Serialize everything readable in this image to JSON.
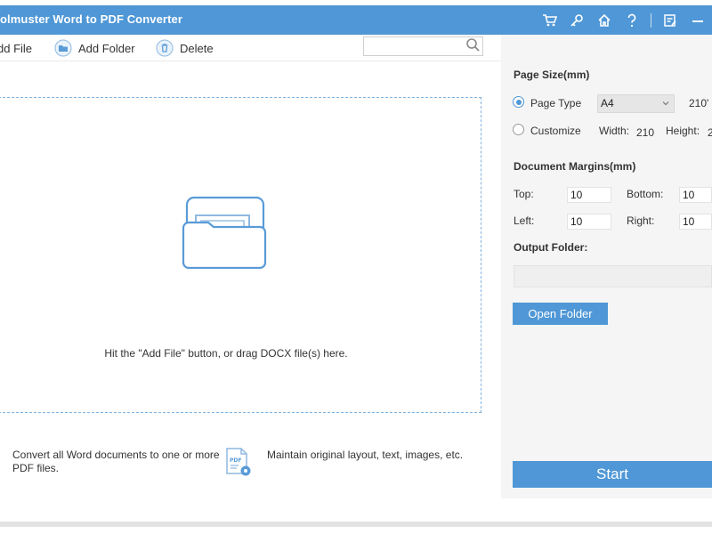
{
  "window": {
    "title": "olmuster Word to PDF Converter",
    "icons": [
      "cart-icon",
      "key-icon",
      "home-icon",
      "help-icon",
      "feedback-icon",
      "minimize-icon"
    ]
  },
  "toolbar": {
    "add_file": "dd File",
    "add_folder": "Add Folder",
    "delete": "Delete",
    "search_value": ""
  },
  "dropzone": {
    "hint": "Hit the \"Add File\" button, or drag DOCX file(s) here."
  },
  "features": {
    "convert": "Convert all Word documents to one or more PDF files.",
    "maintain": "Maintain original layout, text, images, etc."
  },
  "settings": {
    "page_size_title": "Page Size(mm)",
    "page_type_label": "Page Type",
    "page_type_value": "A4",
    "page_type_dims": "210'",
    "customize_label": "Customize",
    "width_label": "Width:",
    "width_value": "210",
    "height_label": "Height:",
    "height_value": "2",
    "selected_size_mode": "page-type",
    "margins_title": "Document Margins(mm)",
    "top_label": "Top:",
    "top_value": "10",
    "bottom_label": "Bottom:",
    "bottom_value": "10",
    "left_label": "Left:",
    "left_value": "10",
    "right_label": "Right:",
    "right_value": "10",
    "output_title": "Output Folder:",
    "output_value": "",
    "open_folder": "Open Folder",
    "start": "Start"
  },
  "colors": {
    "accent": "#4f97d6",
    "panel": "#f5f5f5"
  }
}
